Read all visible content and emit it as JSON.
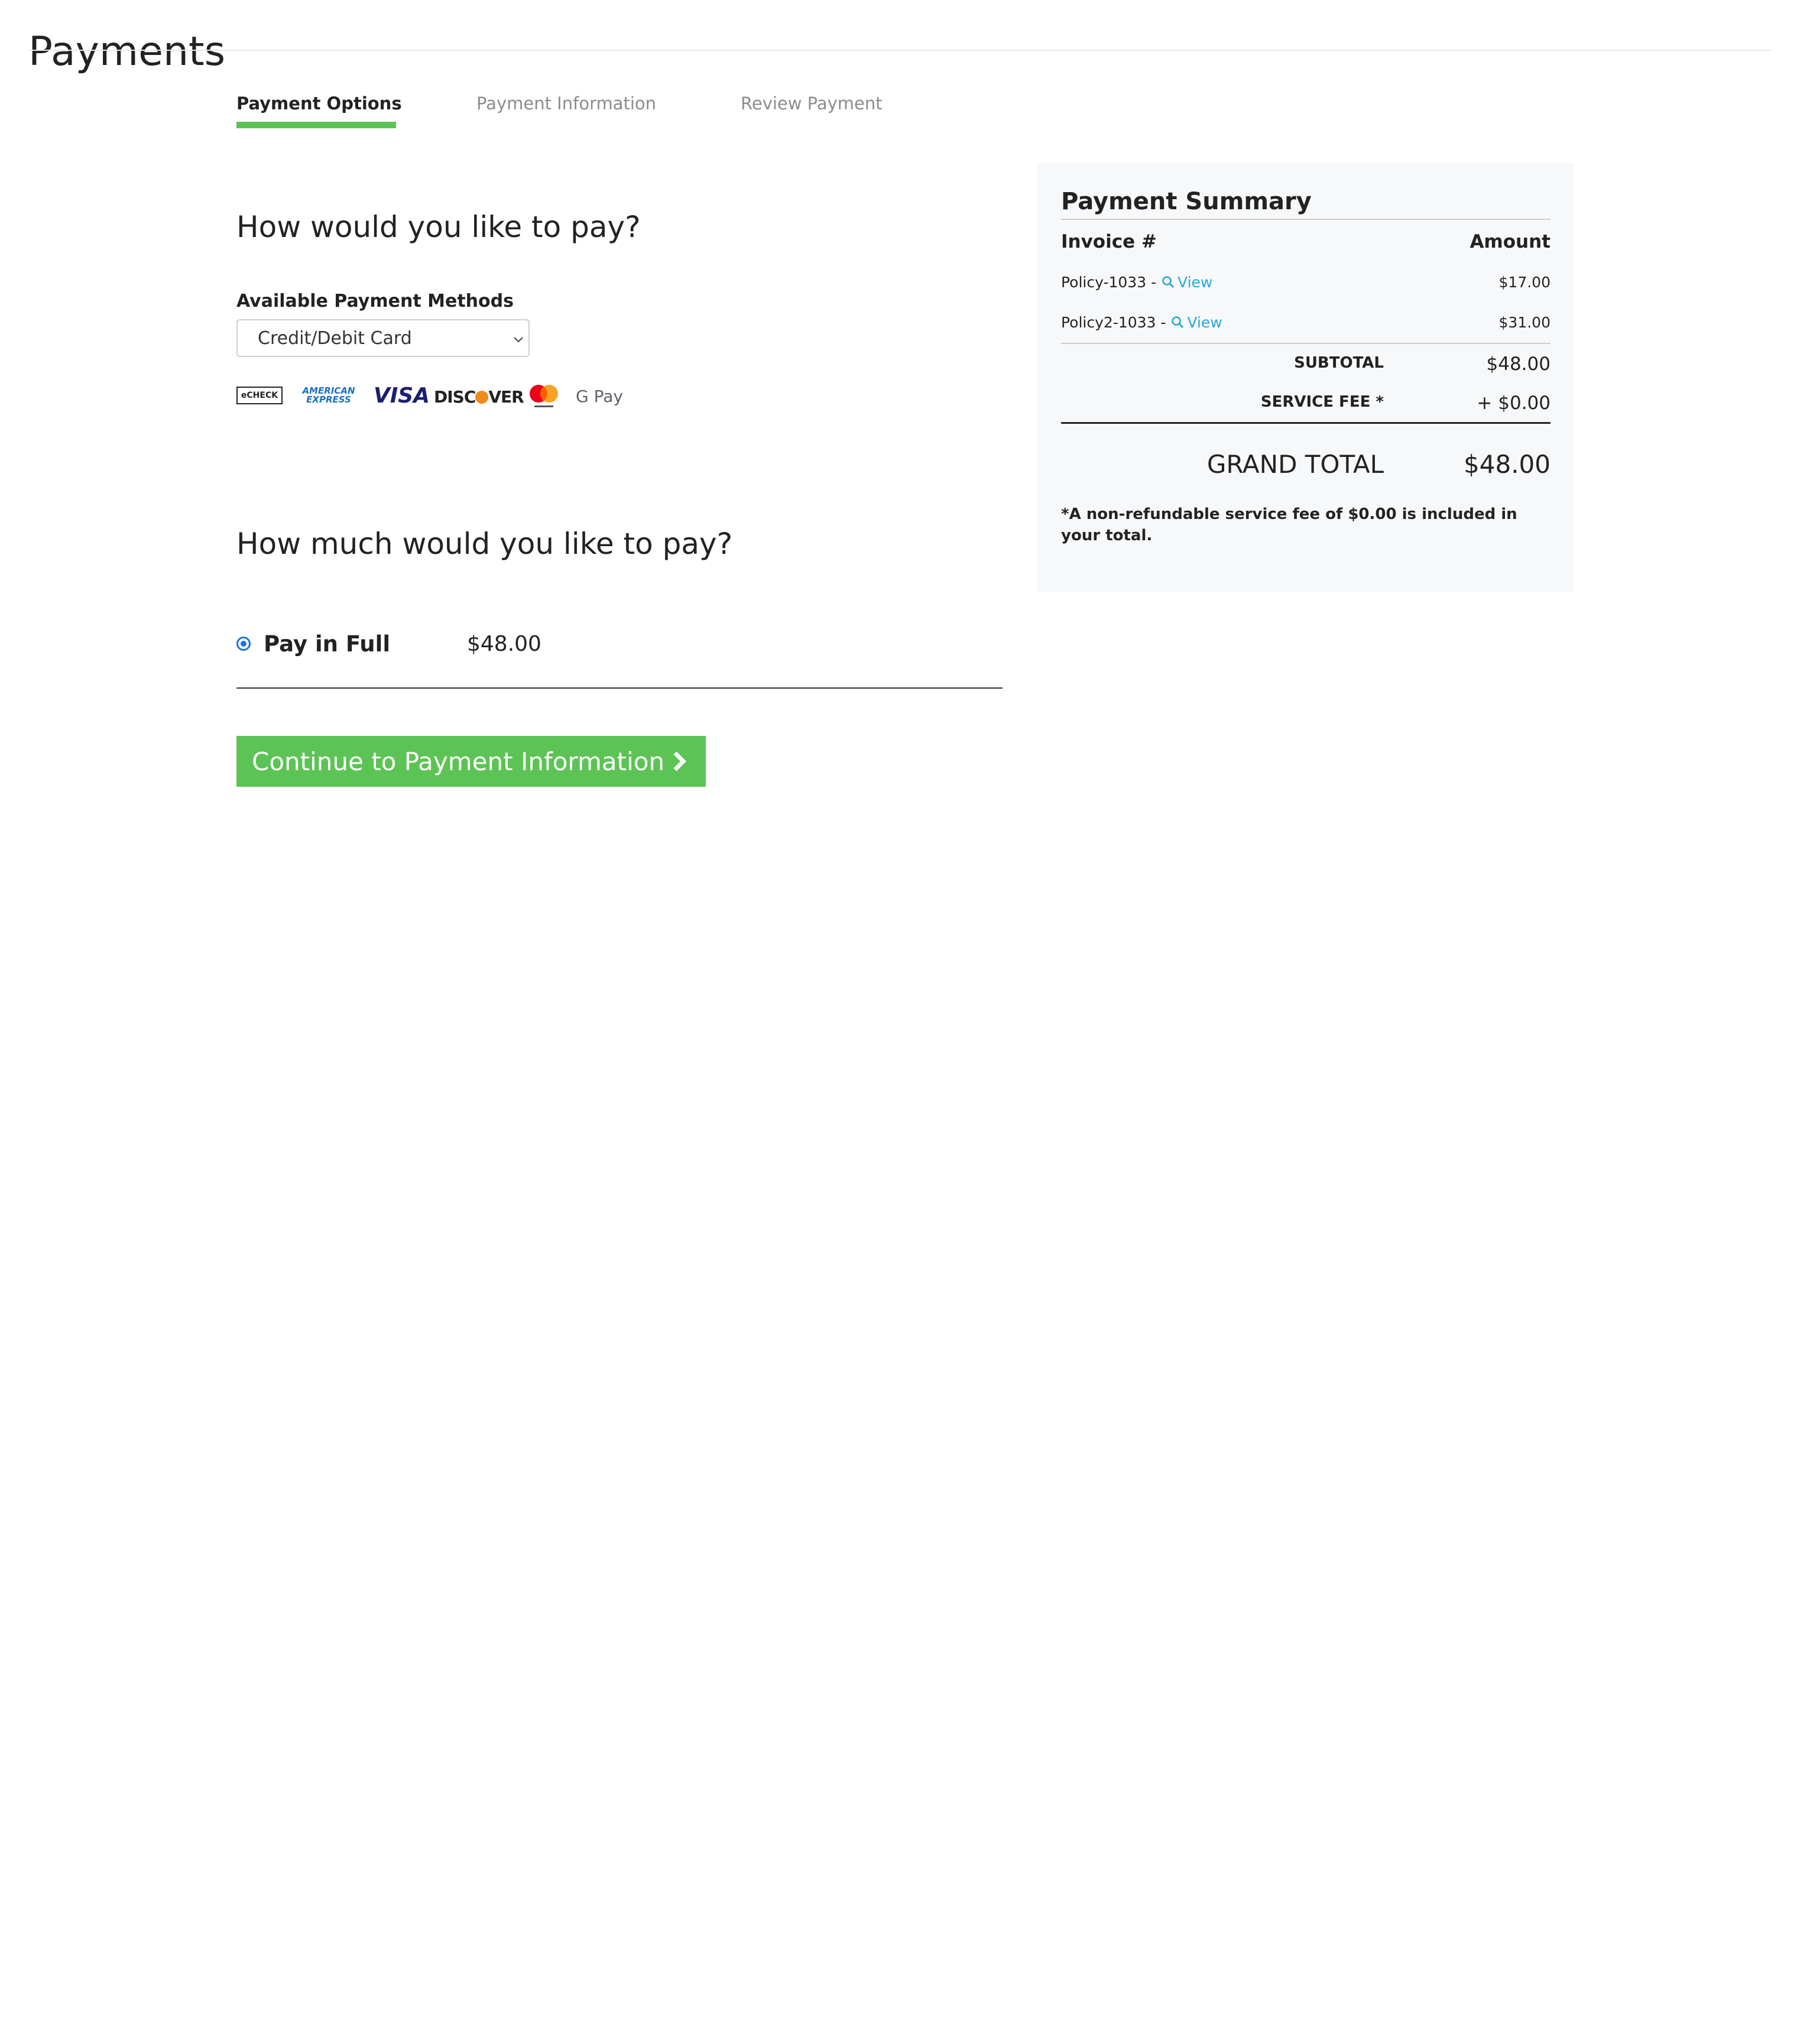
{
  "page": {
    "title": "Payments"
  },
  "steps": [
    {
      "label": "Payment Options",
      "active": true
    },
    {
      "label": "Payment Information",
      "active": false
    },
    {
      "label": "Review Payment",
      "active": false
    }
  ],
  "payment_method": {
    "heading": "How would you like to pay?",
    "label": "Available Payment Methods",
    "selected": "Credit/Debit Card",
    "accepted_logos": {
      "echeck": "eCHECK",
      "amex_line1": "AMERICAN",
      "amex_line2": "EXPRESS",
      "visa": "VISA",
      "discover_a": "DISC",
      "discover_b": "VER",
      "gpay": "G Pay"
    }
  },
  "payment_amount": {
    "heading": "How much would you like to pay?",
    "option_label": "Pay in Full",
    "option_amount": "$48.00",
    "selected": true
  },
  "continue_button": {
    "label": "Continue to Payment Information",
    "icon": "chevron-right-icon"
  },
  "summary": {
    "title": "Payment Summary",
    "col_invoice": "Invoice #",
    "col_amount": "Amount",
    "rows": [
      {
        "invoice": "Policy-1033 - ",
        "link": "View",
        "amount": "$17.00"
      },
      {
        "invoice": "Policy2-1033 - ",
        "link": "View",
        "amount": "$31.00"
      }
    ],
    "subtotal_label": "SUBTOTAL",
    "subtotal_value": "$48.00",
    "fee_label": "SERVICE FEE *",
    "fee_value": "+ $0.00",
    "grand_label": "GRAND TOTAL",
    "grand_value": "$48.00",
    "note": "*A non-refundable service fee of $0.00 is included in your total."
  },
  "colors": {
    "accent_green": "#5cc454",
    "link_blue": "#2aa9d6",
    "radio_blue": "#1a73e8",
    "panel_bg": "#f7f8fa"
  }
}
